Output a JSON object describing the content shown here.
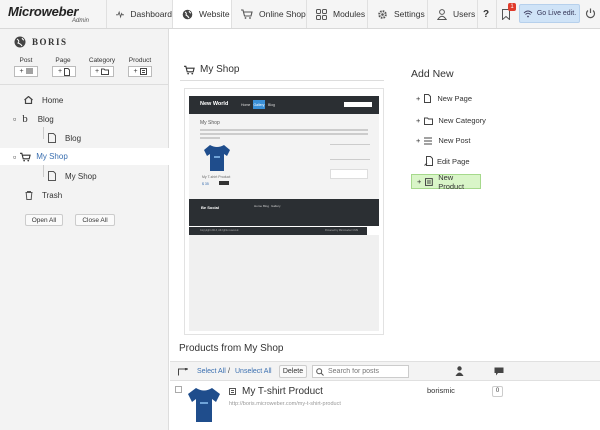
{
  "app": {
    "brand": "Microweber",
    "brand_sub": "Admin"
  },
  "nav": [
    {
      "label": "Dashboard",
      "icon": "pulse-icon"
    },
    {
      "label": "Website",
      "icon": "globe-icon"
    },
    {
      "label": "Online Shop",
      "icon": "cart-icon"
    },
    {
      "label": "Modules",
      "icon": "modules-icon"
    },
    {
      "label": "Settings",
      "icon": "gear-icon"
    },
    {
      "label": "Users",
      "icon": "user-icon"
    }
  ],
  "notifications_count": "1",
  "live_edit_label": "Go Live edit.",
  "sidebar": {
    "site_name": "BORIS",
    "add_buttons": [
      {
        "label": "Post"
      },
      {
        "label": "Page"
      },
      {
        "label": "Category"
      },
      {
        "label": "Product"
      }
    ],
    "tree": [
      {
        "label": "Home"
      },
      {
        "label": "Blog"
      },
      {
        "label": "Blog"
      },
      {
        "label": "My Shop"
      },
      {
        "label": "My Shop"
      },
      {
        "label": "Trash"
      }
    ],
    "open_all": "Open All",
    "close_all": "Close All"
  },
  "main": {
    "page_title": "My Shop",
    "preview": {
      "site_title": "New World",
      "nav_items": [
        "Home",
        "Gallery",
        "Blog"
      ],
      "heading": "My Shop",
      "product_name": "My T-shirt Product",
      "price": "$ 35",
      "footer_brand": "Be Social",
      "footer_nav": [
        "Home",
        "Blog",
        "Gallery"
      ],
      "copyright": "Copyright 2013, All rights reserved.",
      "powered": "Powered by Microweber CMS"
    }
  },
  "add_new": {
    "title": "Add New",
    "items": [
      {
        "label": "New Page",
        "prefix": "+"
      },
      {
        "label": "New Category",
        "prefix": "+"
      },
      {
        "label": "New Post",
        "prefix": "+"
      },
      {
        "label": "Edit Page",
        "prefix": ""
      },
      {
        "label": "New Product",
        "prefix": "+"
      }
    ]
  },
  "products": {
    "title": "Products from My Shop",
    "select_all": "Select All",
    "separator": "/",
    "unselect_all": "Unselect All",
    "delete": "Delete",
    "search_placeholder": "Search for posts",
    "rows": [
      {
        "name": "My T-shirt Product",
        "url": "http://boris.microweber.com/my-t-shirt-product",
        "author": "borismic",
        "comments": "0"
      }
    ]
  },
  "colors": {
    "accent": "#3a6fb0",
    "highlight": "#d9f5c8",
    "live_bg": "#cfe3f7",
    "tshirt": "#1f4d8c"
  }
}
